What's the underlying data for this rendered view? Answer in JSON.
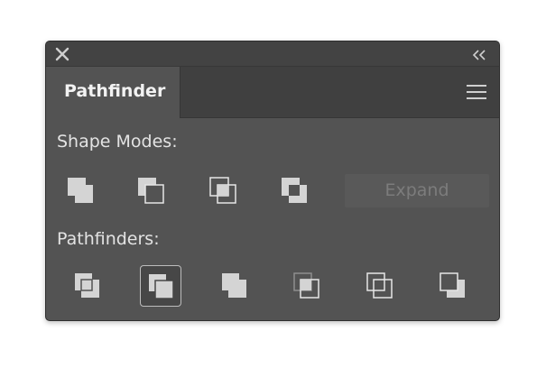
{
  "panel": {
    "tab_label": "Pathfinder",
    "close_icon": "close-icon",
    "collapse_icon": "double-chevron-left-icon",
    "menu_icon": "hamburger-menu-icon"
  },
  "shape_modes": {
    "label": "Shape Modes:",
    "buttons": [
      {
        "name": "unite",
        "icon": "unite-icon"
      },
      {
        "name": "minus-front",
        "icon": "minus-front-icon"
      },
      {
        "name": "intersect",
        "icon": "intersect-icon"
      },
      {
        "name": "exclude",
        "icon": "exclude-icon"
      }
    ],
    "expand_label": "Expand",
    "expand_enabled": false
  },
  "pathfinders": {
    "label": "Pathfinders:",
    "buttons": [
      {
        "name": "divide",
        "icon": "divide-icon"
      },
      {
        "name": "trim",
        "icon": "trim-icon",
        "selected": true
      },
      {
        "name": "merge",
        "icon": "merge-icon"
      },
      {
        "name": "crop",
        "icon": "crop-icon"
      },
      {
        "name": "outline",
        "icon": "outline-icon"
      },
      {
        "name": "minus-back",
        "icon": "minus-back-icon"
      }
    ]
  },
  "colors": {
    "panel_bg": "#535353",
    "tab_bar_bg": "#404040",
    "icon_fill": "#d4d4d4",
    "icon_stroke": "#e6e6e6"
  }
}
